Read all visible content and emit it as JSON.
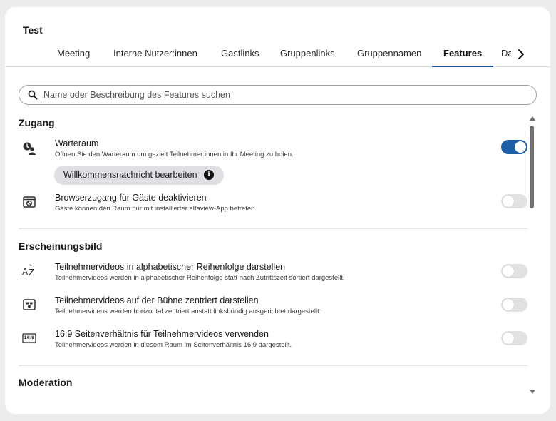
{
  "dialog": {
    "title": "Test"
  },
  "tabs": [
    {
      "label": "Meeting",
      "active": false
    },
    {
      "label": "Interne Nutzer:innen",
      "active": false
    },
    {
      "label": "Gastlinks",
      "active": false
    },
    {
      "label": "Gruppenlinks",
      "active": false
    },
    {
      "label": "Gruppennamen",
      "active": false
    },
    {
      "label": "Features",
      "active": true
    },
    {
      "label": "Da",
      "active": false
    }
  ],
  "search": {
    "placeholder": "Name oder Beschreibung des Features suchen",
    "value": ""
  },
  "sections": [
    {
      "title": "Zugang",
      "features": [
        {
          "icon": "waiting-room-icon",
          "title": "Warteraum",
          "description": "Öffnen Sie den Warteraum um gezielt Teilnehmer:innen in Ihr Meeting zu holen.",
          "enabled": true,
          "action": {
            "label": "Willkommensnachricht bearbeiten",
            "icon": "info-icon"
          }
        },
        {
          "icon": "browser-blocked-icon",
          "title": "Browserzugang für Gäste deaktivieren",
          "description": "Gäste können den Raum nur mit installierter alfaview-App betreten.",
          "enabled": false
        }
      ]
    },
    {
      "title": "Erscheinungsbild",
      "features": [
        {
          "icon": "sort-alphabetical-icon",
          "title": "Teilnehmervideos in alphabetischer Reihenfolge darstellen",
          "description": "Teilnehmervideos werden in alphabetischer Reihenfolge statt nach Zutrittszeit sortiert dargestellt.",
          "enabled": false
        },
        {
          "icon": "stage-center-icon",
          "title": "Teilnehmervideos auf der Bühne zentriert darstellen",
          "description": "Teilnehmervideos werden horizontal zentriert anstatt linksbündig ausgerichtet dargestellt.",
          "enabled": false
        },
        {
          "icon": "aspect-ratio-icon",
          "icon_text": "16:9",
          "title": "16:9 Seitenverhältnis für Teilnehmervideos verwenden",
          "description": "Teilnehmervideos werden in diesem Raum im Seitenverhältnis 16:9 dargestellt.",
          "enabled": false
        }
      ]
    },
    {
      "title": "Moderation",
      "features": []
    }
  ],
  "colors": {
    "accent": "#1f5fa8",
    "toggle_off": "#e1e1e1",
    "chip": "#dedee3"
  }
}
